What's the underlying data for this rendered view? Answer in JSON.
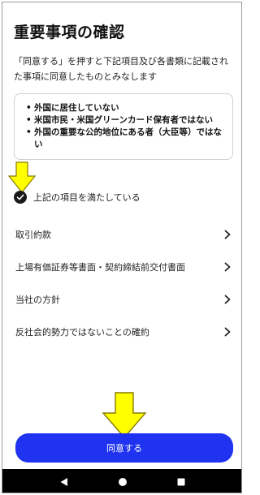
{
  "page": {
    "title": "重要事項の確認",
    "intro": "「同意する」を押すと下記項目及び各書類に記載された事項に同意したものとみなします"
  },
  "conditions": [
    "外国に居住していない",
    "米国市民・米国グリーンカード保有者ではない",
    "外国の重要な公的地位にある者（大臣等）ではない"
  ],
  "confirmation": {
    "label": "上記の項目を満たしている",
    "checked": true
  },
  "menu": [
    {
      "label": "取引約款"
    },
    {
      "label": "上場有価証券等書面・契約締結前交付書面"
    },
    {
      "label": "当社の方針"
    },
    {
      "label": "反社会的勢力ではないことの確約"
    }
  ],
  "agree_button": {
    "label": "同意する"
  },
  "colors": {
    "accent": "#1f33f0",
    "annotation_arrow": "#ffff00",
    "navbar": "#000000"
  },
  "icons": {
    "check": "check-circle-icon",
    "chevron": "chevron-right-icon",
    "nav_back": "back-triangle-icon",
    "nav_home": "home-circle-icon",
    "nav_recents": "recents-square-icon"
  }
}
